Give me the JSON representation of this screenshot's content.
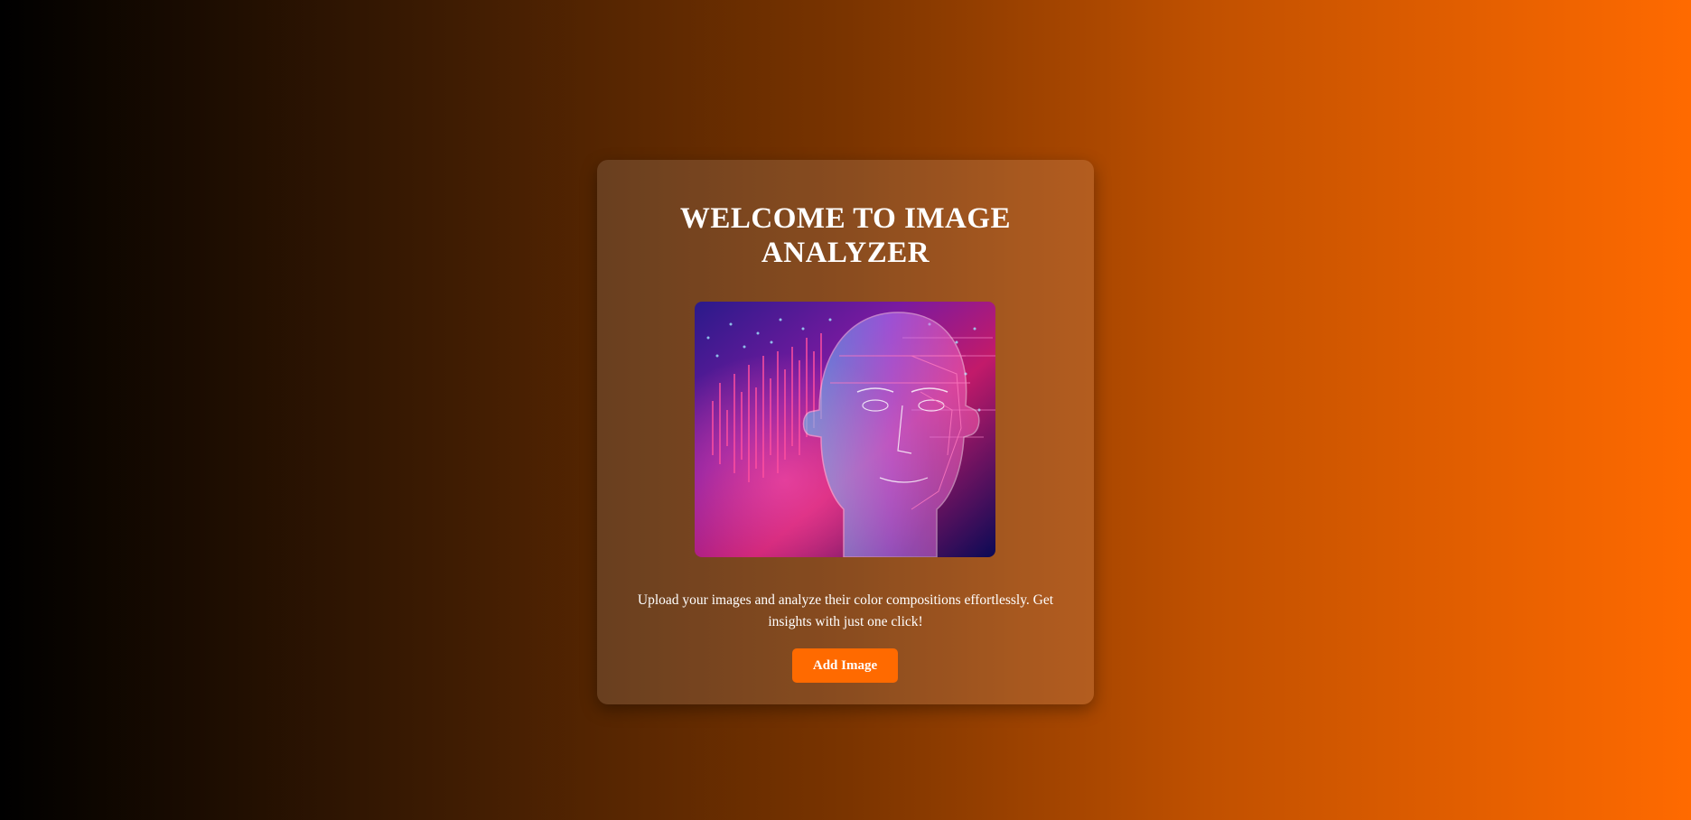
{
  "card": {
    "title": "WELCOME TO IMAGE ANALYZER",
    "hero_image_alt": "Digital wireframe human head with neon data visualization",
    "description": "Upload your images and analyze their color compositions effortlessly. Get insights with just one click!",
    "add_button_label": "Add Image"
  },
  "colors": {
    "background_start": "#000000",
    "background_end": "#ff6a00",
    "accent": "#ff6a00",
    "text": "#ffffff"
  }
}
